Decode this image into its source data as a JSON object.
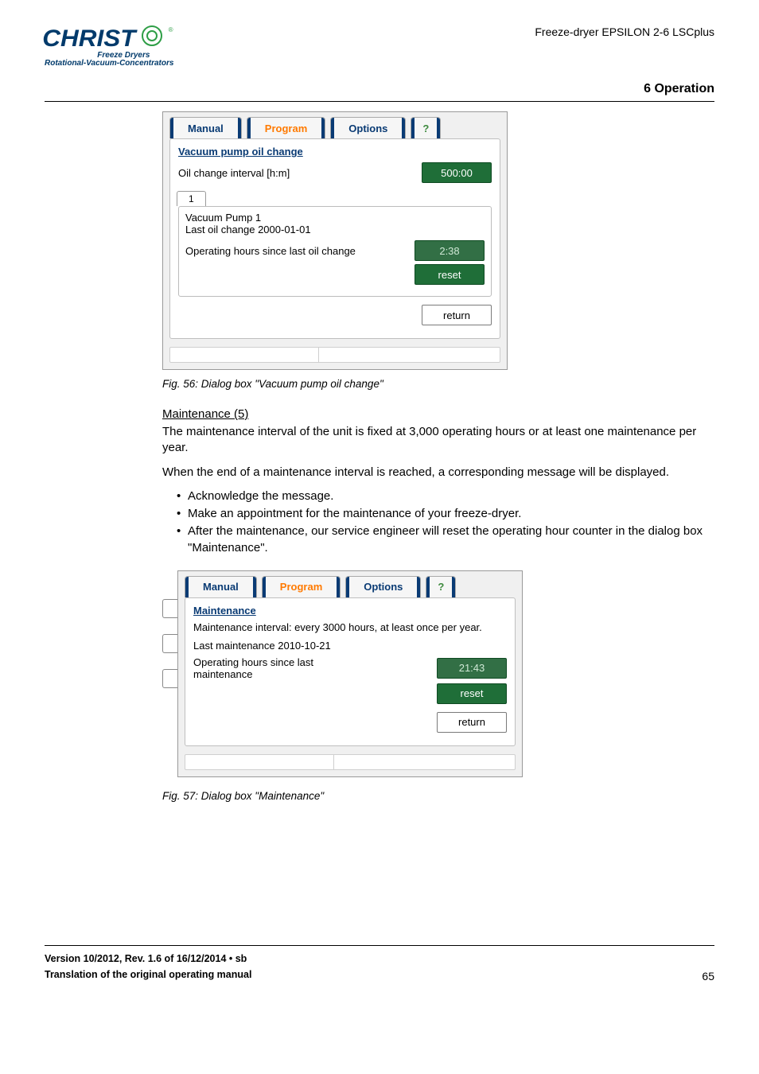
{
  "header": {
    "product_line": "Freeze-dryer EPSILON 2-6 LSCplus",
    "logo_text": "CHRIST",
    "logo_sub1": "Freeze Dryers",
    "logo_sub2": "Rotational-Vacuum-Concentrators",
    "section": "6 Operation"
  },
  "dialog1": {
    "tabs": {
      "manual": "Manual",
      "program": "Program",
      "options": "Options",
      "help": "?"
    },
    "title": "Vacuum pump oil change",
    "interval_label": "Oil change interval [h:m]",
    "interval_value": "500:00",
    "subtab": "1",
    "pump_name": "Vacuum Pump 1",
    "last_change_label": "Last oil change 2000-01-01",
    "op_hours_label": "Operating hours since last oil change",
    "op_hours_value": "2:38",
    "reset": "reset",
    "return": "return"
  },
  "fig56": "Fig. 56: Dialog box \"Vacuum pump oil change\"",
  "maint_section": {
    "heading": "Maintenance (5)",
    "p1": "The maintenance interval of the unit is fixed at 3,000 operating hours or at least one maintenance per year.",
    "p2": "When the end of a maintenance interval is reached, a corresponding message will be displayed.",
    "b1": "Acknowledge the message.",
    "b2": "Make an appointment for the maintenance of your freeze-dryer.",
    "b3": "After the maintenance, our service engineer will reset the operating hour counter in the dialog box \"Maintenance\"."
  },
  "dialog2": {
    "tabs": {
      "manual": "Manual",
      "program": "Program",
      "options": "Options",
      "help": "?"
    },
    "title": "Maintenance",
    "interval_text": "Maintenance interval: every 3000 hours, at least once per year.",
    "last_maint": "Last maintenance 2010-10-21",
    "op_hours_label": "Operating hours since last maintenance",
    "op_hours_value": "21:43",
    "reset": "reset",
    "return": "return"
  },
  "fig57": "Fig. 57: Dialog box \"Maintenance\"",
  "footer": {
    "line1": "Version 10/2012, Rev. 1.6 of 16/12/2014 • sb",
    "line2": "Translation of the original operating manual",
    "page": "65"
  }
}
